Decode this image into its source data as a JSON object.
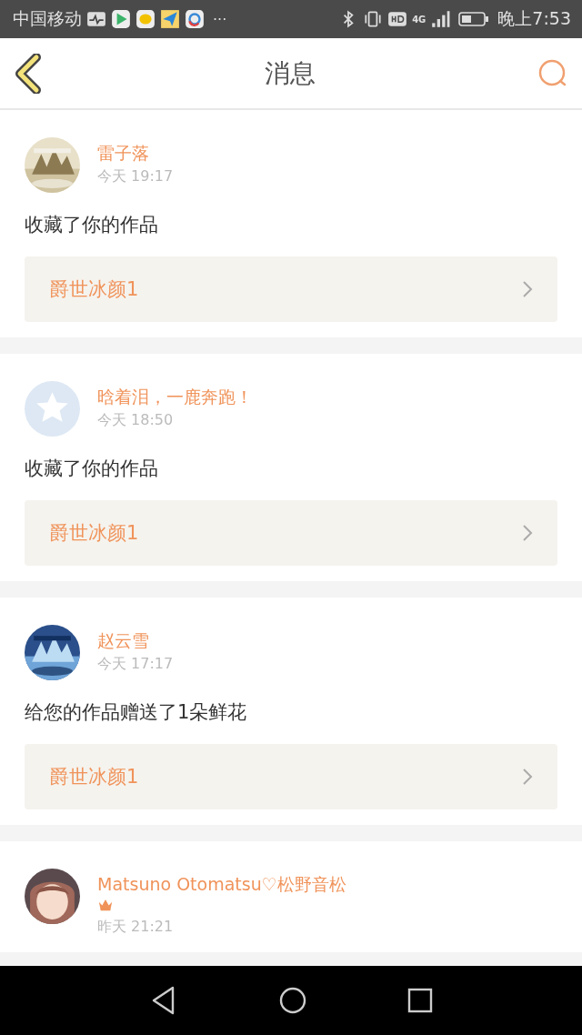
{
  "status_bar": {
    "carrier": "中国移动",
    "more": "···",
    "time": "晚上7:53",
    "network": "4G"
  },
  "header": {
    "title": "消息"
  },
  "messages": [
    {
      "name": "雷子落",
      "vip": false,
      "time": "今天 19:17",
      "text": "收藏了你的作品",
      "work": "爵世冰颜1"
    },
    {
      "avatar": {
        "kind": "default"
      },
      "name": "晗着泪，一鹿奔跑！",
      "vip": false,
      "time": "今天 18:50",
      "text": "收藏了你的作品",
      "work": "爵世冰颜1"
    },
    {
      "name": "赵云雪",
      "vip": false,
      "time": "今天 17:17",
      "text": "给您的作品赠送了1朵鲜花",
      "work": "爵世冰颜1"
    },
    {
      "avatar": {
        "kind": "figure"
      },
      "name": "Matsuno Otomatsu♡松野音松",
      "vip": true,
      "time": "昨天 21:21"
    }
  ]
}
